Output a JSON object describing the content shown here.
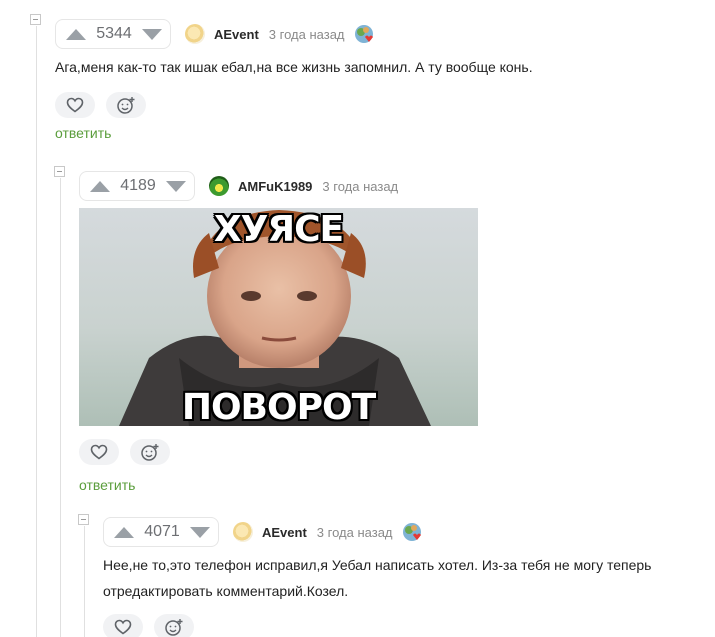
{
  "comments": [
    {
      "rating": "5344",
      "author": "AEvent",
      "time": "3 года назад",
      "text": "Ага,меня как-то так ишак ебал,на все жизнь запомнил. А ту вообще конь.",
      "reply_label": "ответить",
      "avatar_icon": "user-avatar",
      "award_icon": "award-badge-icon"
    },
    {
      "rating": "4189",
      "author": "AMFuK1989",
      "time": "3 года назад",
      "meme_top": "ХУЯСЕ",
      "meme_bottom": "ПОВОРОТ",
      "reply_label": "ответить",
      "avatar_icon": "user-avatar"
    },
    {
      "rating": "4071",
      "author": "AEvent",
      "time": "3 года назад",
      "text": "Нее,не то,это телефон исправил,я Уебал написать хотел. Из-за тебя не могу теперь отредактировать комментарий.Козел.",
      "avatar_icon": "user-avatar",
      "award_icon": "award-badge-icon"
    }
  ],
  "colors": {
    "reply_link": "#5a9d3b",
    "arrow": "#9aa0a6",
    "action_bg": "#f1f2f4"
  }
}
